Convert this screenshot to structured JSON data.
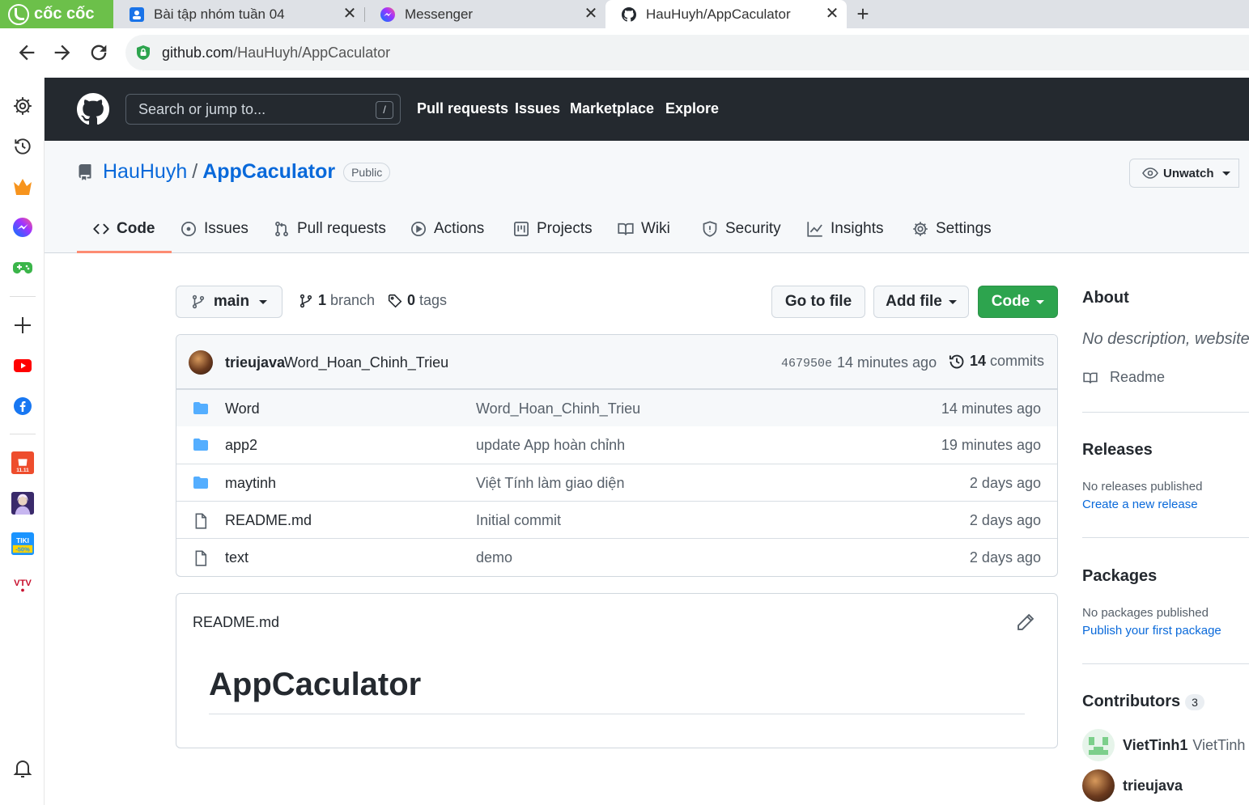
{
  "browser": {
    "brand": "cốc cốc",
    "tabs": [
      {
        "title": "Bài tập nhóm tuần 04",
        "icon": "classroom-icon"
      },
      {
        "title": "Messenger",
        "icon": "messenger-icon"
      },
      {
        "title": "HauHuyh/AppCaculator",
        "icon": "github-icon",
        "active": true
      }
    ],
    "new_tab": "+",
    "url_host": "github.com",
    "url_path": "/HauHuyh/AppCaculator",
    "colors": {
      "brand": "#6cc04a",
      "secure": "#2da44e"
    }
  },
  "sidebar": {
    "icons": [
      "gear-icon",
      "history-icon",
      "crown-icon",
      "messenger-icon",
      "gamepad-icon",
      "plus-icon",
      "youtube-icon",
      "facebook-icon",
      "shopee-icon",
      "game-avatar-icon",
      "tiki-icon",
      "vtv-icon",
      "bell-icon"
    ],
    "tiki_label": "TIKI",
    "tiki_sale": "-50%",
    "vtv_label": "VTV",
    "shopee_sale": "11.11"
  },
  "github_header": {
    "search_placeholder": "Search or jump to...",
    "search_shortcut": "/",
    "nav": [
      "Pull requests",
      "Issues",
      "Marketplace",
      "Explore"
    ]
  },
  "repo": {
    "owner": "HauHuyh",
    "separator": "/",
    "name": "AppCaculator",
    "visibility": "Public",
    "unwatch_label": "Unwatch",
    "tabs": [
      {
        "label": "Code",
        "icon": "code-icon",
        "active": true
      },
      {
        "label": "Issues",
        "icon": "issue-icon"
      },
      {
        "label": "Pull requests",
        "icon": "pull-request-icon"
      },
      {
        "label": "Actions",
        "icon": "play-icon"
      },
      {
        "label": "Projects",
        "icon": "project-icon"
      },
      {
        "label": "Wiki",
        "icon": "book-icon"
      },
      {
        "label": "Security",
        "icon": "shield-icon"
      },
      {
        "label": "Insights",
        "icon": "graph-icon"
      },
      {
        "label": "Settings",
        "icon": "gear-icon"
      }
    ]
  },
  "toolbar": {
    "branch": "main",
    "branch_count": "1",
    "branch_label": "branch",
    "tag_count": "0",
    "tag_label": "tags",
    "go_to_file": "Go to file",
    "add_file": "Add file",
    "code": "Code"
  },
  "latest_commit": {
    "author": "trieujava",
    "message": "Word_Hoan_Chinh_Trieu",
    "sha": "467950e",
    "time": "14 minutes ago",
    "commit_count": "14",
    "commit_label": "commits"
  },
  "files": [
    {
      "name": "Word",
      "type": "folder",
      "message": "Word_Hoan_Chinh_Trieu",
      "age": "14 minutes ago"
    },
    {
      "name": "app2",
      "type": "folder",
      "message": "update App hoàn chỉnh",
      "age": "19 minutes ago"
    },
    {
      "name": "maytinh",
      "type": "folder",
      "message": "Việt Tính làm giao diện",
      "age": "2 days ago"
    },
    {
      "name": "README.md",
      "type": "file",
      "message": "Initial commit",
      "age": "2 days ago"
    },
    {
      "name": "text",
      "type": "file",
      "message": "demo",
      "age": "2 days ago"
    }
  ],
  "readme": {
    "filename": "README.md",
    "heading": "AppCaculator"
  },
  "about": {
    "title": "About",
    "description": "No description, website,",
    "readme_link": "Readme",
    "releases_title": "Releases",
    "releases_text": "No releases published",
    "releases_link": "Create a new release",
    "packages_title": "Packages",
    "packages_text": "No packages published",
    "packages_link": "Publish your first package",
    "contributors_title": "Contributors",
    "contributors_count": "3",
    "contributors": [
      {
        "login": "VietTinh1",
        "name": "VietTinh"
      },
      {
        "login": "trieujava",
        "name": ""
      }
    ]
  }
}
